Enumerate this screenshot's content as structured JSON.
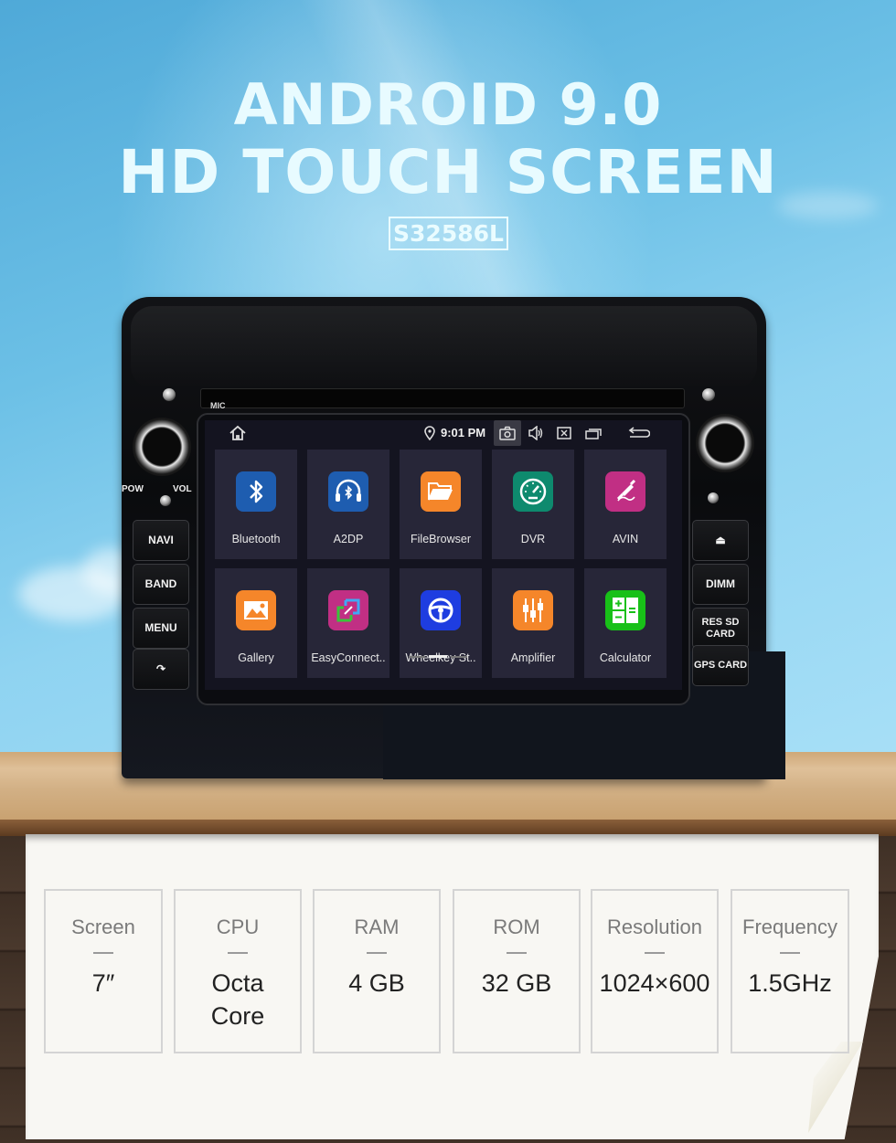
{
  "headline": {
    "line1": "ANDROID 9.0",
    "line2": "HD TOUCH SCREEN",
    "model": "S32586L"
  },
  "device": {
    "mic_label": "MIC",
    "left_labels": {
      "pow": "POW",
      "vol": "VOL"
    },
    "left_buttons": [
      {
        "label": "NAVI"
      },
      {
        "label": "BAND"
      },
      {
        "label": "MENU"
      },
      {
        "label": "",
        "icon": "phone-hangup-icon",
        "glyph": "↷"
      }
    ],
    "right_buttons": [
      {
        "label": "",
        "icon": "eject-icon",
        "glyph": "⏏"
      },
      {
        "label": "DIMM"
      },
      {
        "label": "RES SD CARD"
      },
      {
        "label": "GPS CARD"
      }
    ]
  },
  "screen": {
    "status_bar": {
      "home_icon": "home-icon",
      "location_icon": "location-pin-icon",
      "time": "9:01 PM",
      "icons": [
        "camera-icon",
        "volume-icon",
        "close-box-icon",
        "recent-apps-icon",
        "back-icon"
      ]
    },
    "apps": [
      {
        "label": "Bluetooth",
        "icon": "bluetooth-icon",
        "color": "#1e5db0"
      },
      {
        "label": "A2DP",
        "icon": "bluetooth-headphones-icon",
        "color": "#1e5db0"
      },
      {
        "label": "FileBrowser",
        "icon": "folder-icon",
        "color": "#f5862a"
      },
      {
        "label": "DVR",
        "icon": "speedometer-icon",
        "color": "#0e8a6e"
      },
      {
        "label": "AVIN",
        "icon": "audio-jack-icon",
        "color": "#c12f84"
      },
      {
        "label": "Gallery",
        "icon": "image-icon",
        "color": "#f5862a"
      },
      {
        "label": "EasyConnect..",
        "icon": "screen-mirror-icon",
        "color": "#c12f84"
      },
      {
        "label": "Wheelkey St..",
        "icon": "steering-wheel-icon",
        "color": "#1e3de0"
      },
      {
        "label": "Amplifier",
        "icon": "equalizer-icon",
        "color": "#f5862a"
      },
      {
        "label": "Calculator",
        "icon": "calculator-icon",
        "color": "#18c018"
      }
    ],
    "page_indicator": {
      "pages": 3,
      "active": 2
    }
  },
  "specs": [
    {
      "label": "Screen",
      "value": "7″"
    },
    {
      "label": "CPU",
      "value": "Octa Core"
    },
    {
      "label": "RAM",
      "value": "4 GB"
    },
    {
      "label": "ROM",
      "value": "32 GB"
    },
    {
      "label": "Resolution",
      "value": "1024×600"
    },
    {
      "label": "Frequency",
      "value": "1.5GHz"
    }
  ]
}
